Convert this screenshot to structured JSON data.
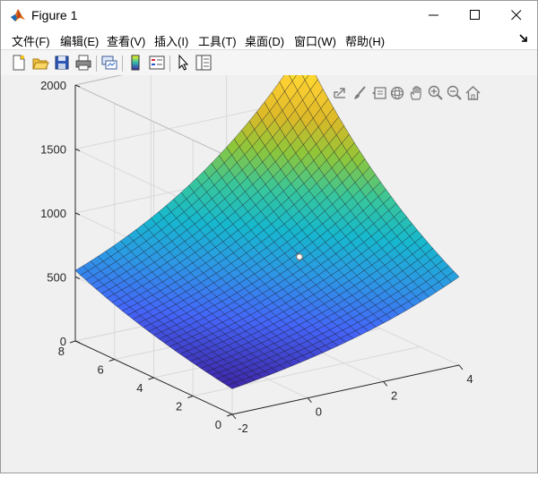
{
  "window": {
    "title": "Figure 1"
  },
  "menu": {
    "items": [
      {
        "label": "文件(F)"
      },
      {
        "label": "编辑(E)"
      },
      {
        "label": "查看(V)"
      },
      {
        "label": "插入(I)"
      },
      {
        "label": "工具(T)"
      },
      {
        "label": "桌面(D)"
      },
      {
        "label": "窗口(W)"
      },
      {
        "label": "帮助(H)"
      }
    ]
  },
  "toolbar": {
    "buttons": [
      {
        "icon": "new-figure-icon"
      },
      {
        "icon": "open-file-icon"
      },
      {
        "icon": "save-icon"
      },
      {
        "icon": "print-icon"
      },
      {
        "icon": "link-plot-icon"
      },
      {
        "icon": "insert-colorbar-icon"
      },
      {
        "icon": "insert-legend-icon"
      },
      {
        "icon": "edit-plot-icon"
      },
      {
        "icon": "property-inspector-icon"
      }
    ]
  },
  "axes_toolbar": {
    "buttons": [
      {
        "icon": "export-icon"
      },
      {
        "icon": "brush-icon"
      },
      {
        "icon": "data-tips-icon"
      },
      {
        "icon": "rotate-3d-icon"
      },
      {
        "icon": "pan-icon"
      },
      {
        "icon": "zoom-in-icon"
      },
      {
        "icon": "zoom-out-icon"
      },
      {
        "icon": "home-icon"
      }
    ]
  },
  "chart_data": {
    "type": "surface",
    "x_ticks": [
      -2,
      0,
      2,
      4
    ],
    "y_ticks": [
      0,
      2,
      4,
      6,
      8
    ],
    "z_ticks": [
      0,
      500,
      1000,
      1500,
      2000
    ],
    "xlim": [
      -2,
      4
    ],
    "ylim": [
      0,
      8
    ],
    "zlim": [
      0,
      2000
    ],
    "z_min": 200,
    "z_max": 1900,
    "grid": true,
    "colormap": "parula",
    "colors": [
      "#3e26a8",
      "#4465f8",
      "#2d97e5",
      "#16b8ce",
      "#38c69a",
      "#8ec63a",
      "#ddb927",
      "#fcd032",
      "#f9fb15"
    ]
  }
}
